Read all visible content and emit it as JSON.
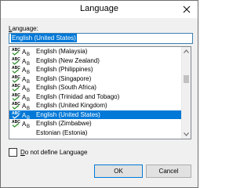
{
  "window": {
    "title": "Language",
    "close_icon": "close-icon"
  },
  "language_field": {
    "label_mnemonic": "L",
    "label_rest": "anguage:",
    "value": "English (United States)"
  },
  "language_list": {
    "items": [
      {
        "label": "English (Malaysia)",
        "spellcheck": true,
        "selected": false
      },
      {
        "label": "English (New Zealand)",
        "spellcheck": true,
        "selected": false
      },
      {
        "label": "English (Philippines)",
        "spellcheck": true,
        "selected": false
      },
      {
        "label": "English (Singapore)",
        "spellcheck": true,
        "selected": false
      },
      {
        "label": "English (South Africa)",
        "spellcheck": true,
        "selected": false
      },
      {
        "label": "English (Trinidad and Tobago)",
        "spellcheck": true,
        "selected": false
      },
      {
        "label": "English (United Kingdom)",
        "spellcheck": true,
        "selected": false
      },
      {
        "label": "English (United States)",
        "spellcheck": true,
        "selected": true
      },
      {
        "label": "English (Zimbabwe)",
        "spellcheck": true,
        "selected": false
      },
      {
        "label": "Estonian (Estonia)",
        "spellcheck": false,
        "selected": false
      }
    ],
    "spell_icon": {
      "abc": "ABC",
      "a": "A",
      "b": "B"
    },
    "selected_color": "#0078d7"
  },
  "options": {
    "do_not_define_mnemonic": "D",
    "do_not_define_rest": "o not define Language"
  },
  "buttons": {
    "ok_label": "OK",
    "cancel_label": "Cancel"
  }
}
